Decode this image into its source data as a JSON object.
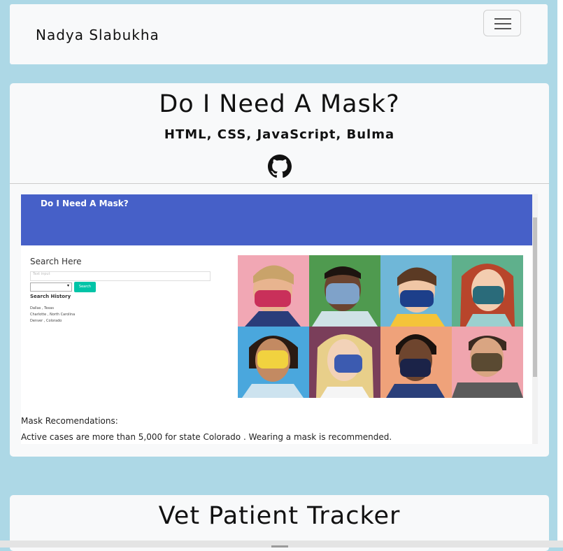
{
  "navbar": {
    "brand": "Nadya Slabukha",
    "toggle_icon": "hamburger-menu-icon"
  },
  "projects": [
    {
      "title": "Do I Need A Mask?",
      "technologies": "HTML, CSS, JavaScript, Bulma",
      "link_icon": "github-icon",
      "screenshot": {
        "header_title": "Do I Need A Mask?",
        "search_title": "Search Here",
        "input_placeholder": "Text input",
        "search_button": "Search",
        "history_title": "Search History",
        "history": [
          "Dallas , Texas",
          "Charlotte , North Carolina",
          "Denver , Colorado"
        ],
        "recommendations_title": "Mask Recomendations:",
        "recommendation_text": "Active cases are more than 5,000 for state Colorado . Wearing a mask is recommended.",
        "header_color": "#4660c8",
        "button_color": "#00c4a7"
      }
    },
    {
      "title": "Vet Patient Tracker"
    }
  ],
  "colors": {
    "page_background": "#add8e6",
    "card_background": "#f8f9fa"
  }
}
